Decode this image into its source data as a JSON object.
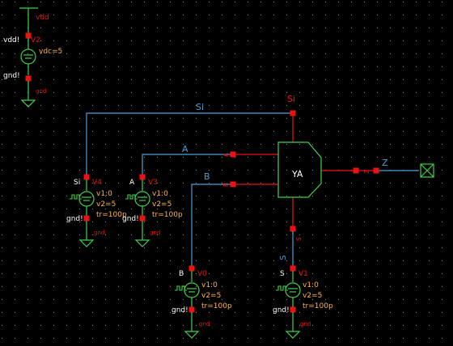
{
  "colors": {
    "background": "#000000",
    "wire": "#4a9edc",
    "device": "#3fd24a",
    "pin": "#ee1111",
    "pin_text": "#ee1111",
    "param_text": "#ffb347",
    "net_text": "#4a9edc",
    "name_text": "#ffffff"
  },
  "icons": [
    "dc-source-icon",
    "pulse-source-icon",
    "ground-icon",
    "output-pin-icon"
  ],
  "vdd_source": {
    "supply_label": "vdd",
    "pos_label": "vdd!",
    "instance": "V2",
    "param": "vdc=5",
    "neg_label": "gnd!",
    "gnd_label": "gnd"
  },
  "sources": [
    {
      "id": "v4",
      "plus": "Si",
      "instance": "V4",
      "p1": "v1:0",
      "p2": "v2=5",
      "p3": "tr=100p",
      "minus": "gnd!",
      "gnd": "gnd"
    },
    {
      "id": "v3",
      "plus": "A",
      "instance": "V3",
      "p1": "v1:0",
      "p2": "v2=5",
      "p3": "tr=100p",
      "minus": "gnd!",
      "gnd": "gnd"
    },
    {
      "id": "v0",
      "plus": "B",
      "instance": "V0",
      "p1": "v1:0",
      "p2": "v2=5",
      "p3": "tr=100p",
      "minus": "gnd!",
      "gnd": "gnd"
    },
    {
      "id": "v1",
      "plus": "S",
      "instance": "V1",
      "p1": "v1:0",
      "p2": "v2=5",
      "p3": "tr=100p",
      "minus": "gnd!",
      "gnd": "gnd"
    }
  ],
  "nets": {
    "si": "Si",
    "a": "A",
    "b": "B",
    "z": "Z",
    "s": "S",
    "si_pin": "Si"
  },
  "cell": {
    "name": "YA",
    "pin_a": "A",
    "pin_b": "B",
    "pin_s": "S",
    "pin_z": "Z"
  }
}
